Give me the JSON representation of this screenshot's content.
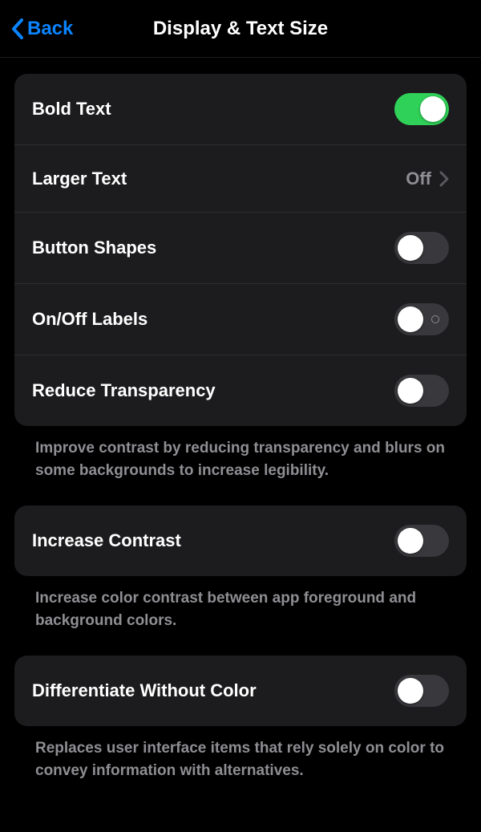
{
  "nav": {
    "back_label": "Back",
    "title": "Display & Text Size"
  },
  "group1": {
    "bold_text": {
      "label": "Bold Text",
      "on": true
    },
    "larger_text": {
      "label": "Larger Text",
      "value": "Off"
    },
    "button_shapes": {
      "label": "Button Shapes",
      "on": false
    },
    "on_off_labels": {
      "label": "On/Off Labels",
      "on": false,
      "show_indicator": true
    },
    "reduce_transparency": {
      "label": "Reduce Transparency",
      "on": false
    },
    "footer": "Improve contrast by reducing transparency and blurs on some backgrounds to increase legibility."
  },
  "group2": {
    "increase_contrast": {
      "label": "Increase Contrast",
      "on": false
    },
    "footer": "Increase color contrast between app foreground and background colors."
  },
  "group3": {
    "differentiate": {
      "label": "Differentiate Without Color",
      "on": false
    },
    "footer": "Replaces user interface items that rely solely on color to convey information with alternatives."
  }
}
